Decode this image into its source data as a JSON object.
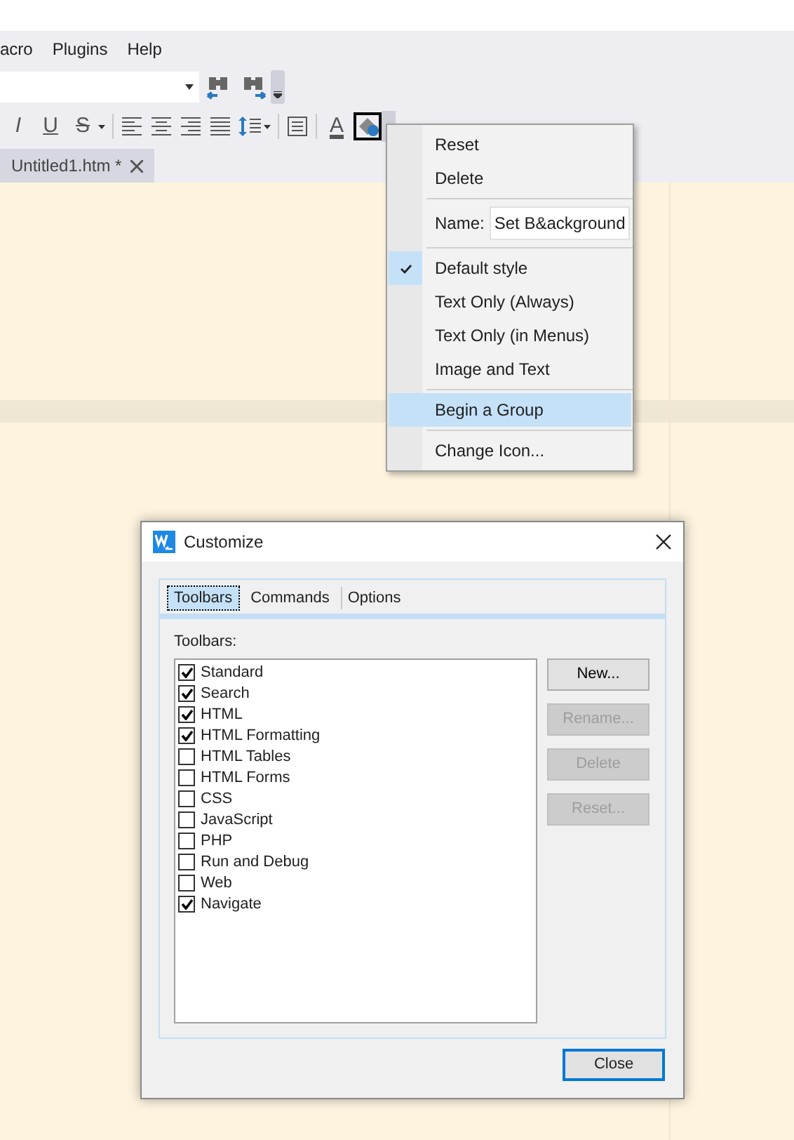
{
  "menu_bar": [
    {
      "label": "acro"
    },
    {
      "label": "Plugins"
    },
    {
      "label": "Help"
    }
  ],
  "format_toolbar": [
    {
      "kind": "italic",
      "glyph": "I",
      "selected": false
    },
    {
      "kind": "underline",
      "glyph": "U",
      "selected": false
    },
    {
      "kind": "strike",
      "glyph": "S",
      "selected": false
    },
    {
      "kind": "separator"
    },
    {
      "kind": "align_left",
      "selected": false
    },
    {
      "kind": "align_center",
      "selected": false
    },
    {
      "kind": "align_right",
      "selected": false
    },
    {
      "kind": "justify",
      "selected": false
    },
    {
      "kind": "line_spacing",
      "selected": false
    },
    {
      "kind": "separator"
    },
    {
      "kind": "block",
      "selected": false
    },
    {
      "kind": "separator"
    },
    {
      "kind": "font_color",
      "glyph": "A",
      "selected": false
    },
    {
      "kind": "background_color",
      "selected": true
    }
  ],
  "document_tabs": [
    {
      "label": "Untitled1.htm *",
      "selected": true
    }
  ],
  "context_menu": {
    "items": [
      {
        "kind": "command",
        "label": "Reset",
        "checked": false,
        "highlighted": false
      },
      {
        "kind": "command",
        "label": "Delete",
        "checked": false,
        "highlighted": false
      },
      {
        "kind": "separator"
      },
      {
        "kind": "name_field",
        "label": "Name:",
        "value": "Set B&ackground"
      },
      {
        "kind": "separator"
      },
      {
        "kind": "command",
        "label": "Default style",
        "checked": true,
        "highlighted": false
      },
      {
        "kind": "command",
        "label": "Text Only (Always)",
        "checked": false,
        "highlighted": false
      },
      {
        "kind": "command",
        "label": "Text Only (in Menus)",
        "checked": false,
        "highlighted": false
      },
      {
        "kind": "command",
        "label": "Image and Text",
        "checked": false,
        "highlighted": false
      },
      {
        "kind": "separator"
      },
      {
        "kind": "command",
        "label": "Begin a Group",
        "checked": false,
        "highlighted": true
      },
      {
        "kind": "separator"
      },
      {
        "kind": "command",
        "label": "Change Icon...",
        "checked": false,
        "highlighted": false
      }
    ]
  },
  "dialog": {
    "title": "Customize",
    "tabs": [
      {
        "label": "Toolbars",
        "selected": true
      },
      {
        "label": "Commands",
        "selected": false
      },
      {
        "label": "Options",
        "selected": false
      }
    ],
    "list_label": "Toolbars:",
    "toolbars": [
      {
        "label": "Standard",
        "checked": true
      },
      {
        "label": "Search",
        "checked": true
      },
      {
        "label": "HTML",
        "checked": true
      },
      {
        "label": "HTML Formatting",
        "checked": true
      },
      {
        "label": "HTML Tables",
        "checked": false
      },
      {
        "label": "HTML Forms",
        "checked": false
      },
      {
        "label": "CSS",
        "checked": false
      },
      {
        "label": "JavaScript",
        "checked": false
      },
      {
        "label": "PHP",
        "checked": false
      },
      {
        "label": "Run and Debug",
        "checked": false
      },
      {
        "label": "Web",
        "checked": false
      },
      {
        "label": "Navigate",
        "checked": true
      }
    ],
    "buttons": [
      {
        "label": "New...",
        "disabled": false
      },
      {
        "label": "Rename...",
        "disabled": true
      },
      {
        "label": "Delete",
        "disabled": true
      },
      {
        "label": "Reset...",
        "disabled": true
      }
    ],
    "close_button": {
      "label": "Close",
      "default": true
    }
  }
}
